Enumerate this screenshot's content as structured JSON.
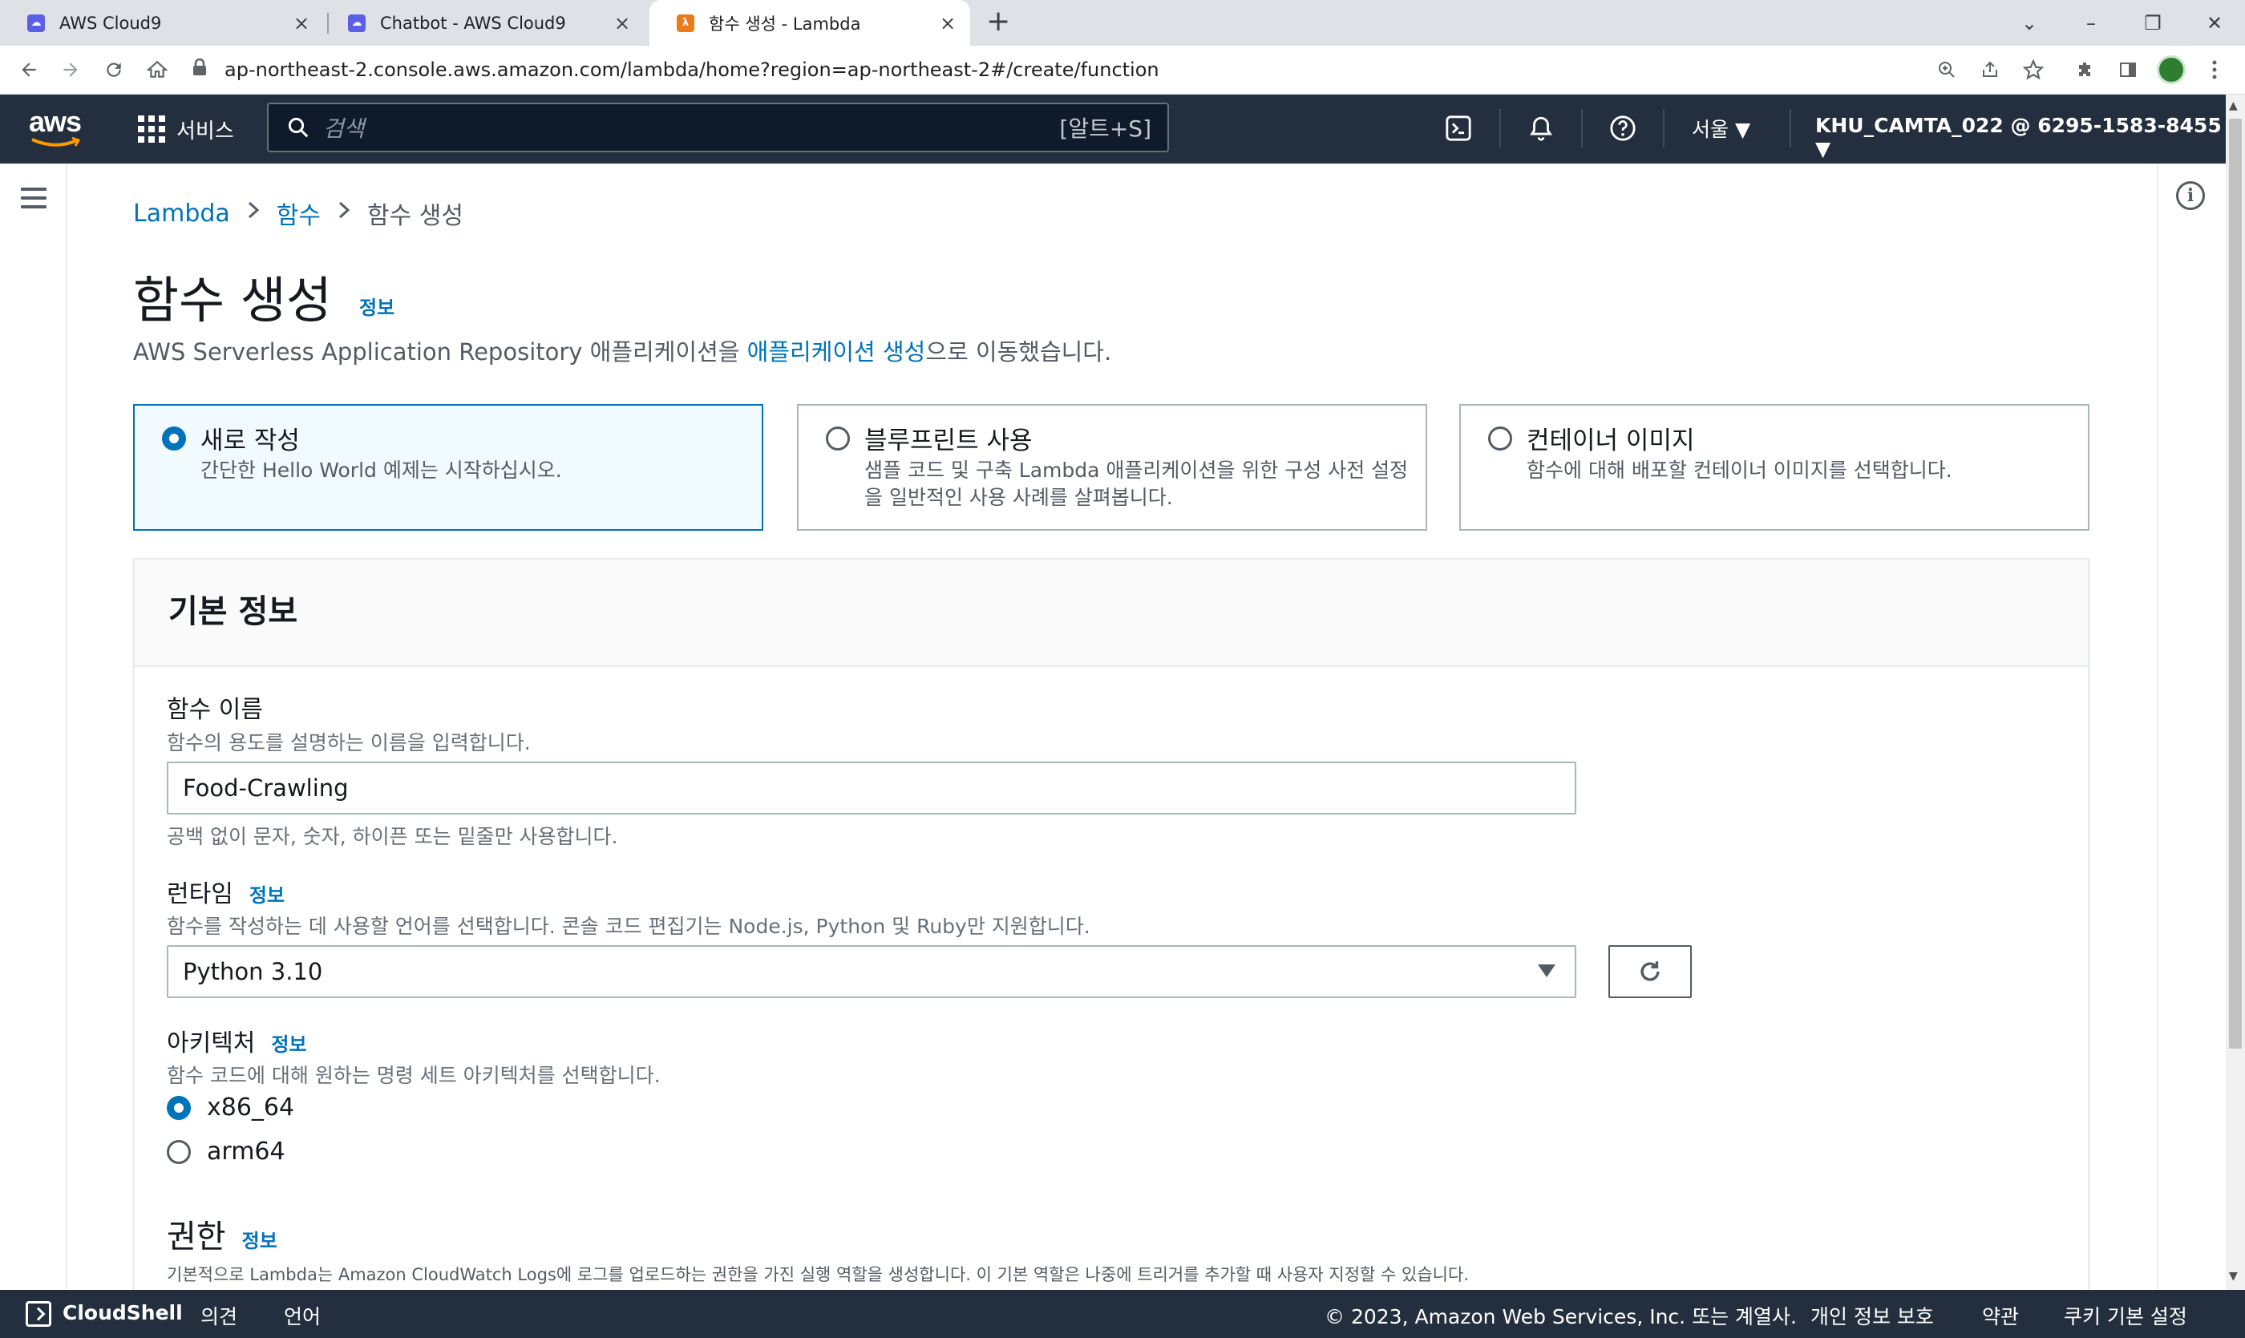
{
  "browser": {
    "tabs": [
      {
        "title": "AWS Cloud9",
        "icon": "cloud9-icon",
        "active": false
      },
      {
        "title": "Chatbot - AWS Cloud9",
        "icon": "cloud9-icon",
        "active": false
      },
      {
        "title": "함수 생성 - Lambda",
        "icon": "lambda-icon",
        "active": true
      }
    ],
    "url": "ap-northeast-2.console.aws.amazon.com/lambda/home?region=ap-northeast-2#/create/function"
  },
  "awsnav": {
    "logo_text": "aws",
    "services_label": "서비스",
    "search_placeholder": "검색",
    "search_shortcut": "[알트+S]",
    "region": "서울 ▼",
    "account": "KHU_CAMTA_022 @ 6295-1583-8455 ▼"
  },
  "breadcrumb": {
    "items": [
      "Lambda",
      "함수",
      "함수 생성"
    ]
  },
  "page": {
    "title": "함수 생성",
    "title_info": "정보",
    "subtitle_prefix": "AWS Serverless Application Repository 애플리케이션을 ",
    "subtitle_link": "애플리케이션 생성",
    "subtitle_suffix": "으로 이동했습니다."
  },
  "options": [
    {
      "title": "새로 작성",
      "desc": "간단한 Hello World 예제는 시작하십시오.",
      "selected": true
    },
    {
      "title": "블루프린트 사용",
      "desc": "샘플 코드 및 구축 Lambda 애플리케이션을 위한 구성 사전 설정을 일반적인 사용 사례를 살펴봅니다.",
      "selected": false
    },
    {
      "title": "컨테이너 이미지",
      "desc": "함수에 대해 배포할 컨테이너 이미지를 선택합니다.",
      "selected": false
    }
  ],
  "basic_info": {
    "title": "기본 정보",
    "function_name": {
      "label": "함수 이름",
      "desc": "함수의 용도를 설명하는 이름을 입력합니다.",
      "value": "Food-Crawling",
      "constraint": "공백 없이 문자, 숫자, 하이픈 또는 밑줄만 사용합니다."
    },
    "runtime": {
      "label": "런타임",
      "info": "정보",
      "desc": "함수를 작성하는 데 사용할 언어를 선택합니다. 콘솔 코드 편집기는 Node.js, Python 및 Ruby만 지원합니다.",
      "value": "Python 3.10"
    },
    "architecture": {
      "label": "아키텍처",
      "info": "정보",
      "desc": "함수 코드에 대해 원하는 명령 세트 아키텍처를 선택합니다.",
      "options": [
        {
          "label": "x86_64",
          "selected": true
        },
        {
          "label": "arm64",
          "selected": false
        }
      ]
    },
    "permissions": {
      "label": "권한",
      "info": "정보",
      "desc": "기본적으로 Lambda는 Amazon CloudWatch Logs에 로그를 업로드하는 권한을 가진 실행 역할을 생성합니다. 이 기본 역할은 나중에 트리거를 추가할 때 사용자 지정할 수 있습니다."
    }
  },
  "footer": {
    "cloudshell": "CloudShell",
    "feedback": "의견",
    "language": "언어",
    "copyright": "© 2023, Amazon Web Services, Inc. 또는 계열사.",
    "privacy": "개인 정보 보호",
    "terms": "약관",
    "cookies": "쿠키 기본 설정"
  },
  "colors": {
    "aws_nav": "#232f3e",
    "link": "#0073bb",
    "selected_bg": "#f1faff"
  }
}
